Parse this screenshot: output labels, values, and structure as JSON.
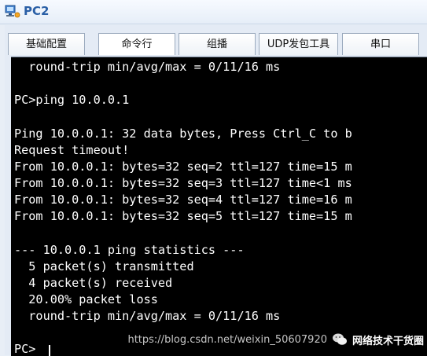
{
  "window": {
    "title": "PC2"
  },
  "tabs": [
    {
      "label": "基础配置",
      "active": false
    },
    {
      "label": "命令行",
      "active": true
    },
    {
      "label": "组播",
      "active": false
    },
    {
      "label": "UDP发包工具",
      "active": false
    },
    {
      "label": "串口",
      "active": false
    }
  ],
  "terminal": {
    "lines": [
      "  round-trip min/avg/max = 0/11/16 ms",
      "",
      "PC>ping 10.0.0.1",
      "",
      "Ping 10.0.0.1: 32 data bytes, Press Ctrl_C to b",
      "Request timeout!",
      "From 10.0.0.1: bytes=32 seq=2 ttl=127 time=15 m",
      "From 10.0.0.1: bytes=32 seq=3 ttl=127 time<1 ms",
      "From 10.0.0.1: bytes=32 seq=4 ttl=127 time=16 m",
      "From 10.0.0.1: bytes=32 seq=5 ttl=127 time=15 m",
      "",
      "--- 10.0.0.1 ping statistics ---",
      "  5 packet(s) transmitted",
      "  4 packet(s) received",
      "  20.00% packet loss",
      "  round-trip min/avg/max = 0/11/16 ms",
      "",
      "PC>"
    ]
  },
  "watermark": {
    "url": "https://blog.csdn.net/weixin_50607920",
    "name": "网络技术干货圈"
  },
  "colors": {
    "terminal_bg": "#000000",
    "terminal_fg": "#ffffff",
    "title_color": "#2a5fa6"
  }
}
